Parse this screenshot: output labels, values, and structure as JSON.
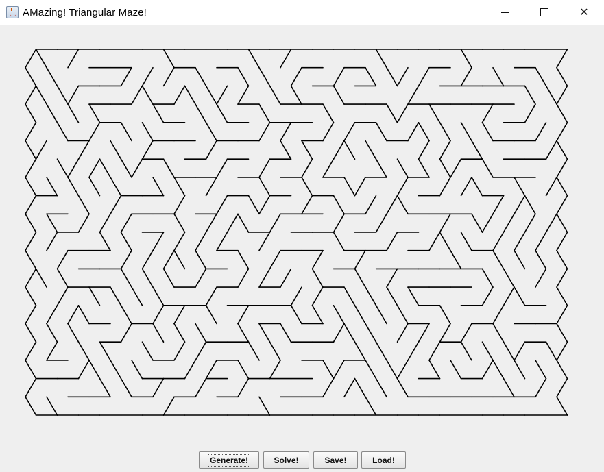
{
  "window": {
    "title": "AMazing! Triangular Maze!",
    "app_icon": "java-cup-icon",
    "controls": {
      "minimize_icon": "minimize-icon",
      "maximize_icon": "maximize-icon",
      "close_icon": "close-icon",
      "close_glyph": "✕"
    }
  },
  "maze": {
    "grid": "triangular",
    "rows": 20,
    "columns": 50,
    "wall_color": "#000000",
    "background_color": "#efefef"
  },
  "buttons": {
    "generate": "Generate!",
    "solve": "Solve!",
    "save": "Save!",
    "load": "Load!"
  }
}
